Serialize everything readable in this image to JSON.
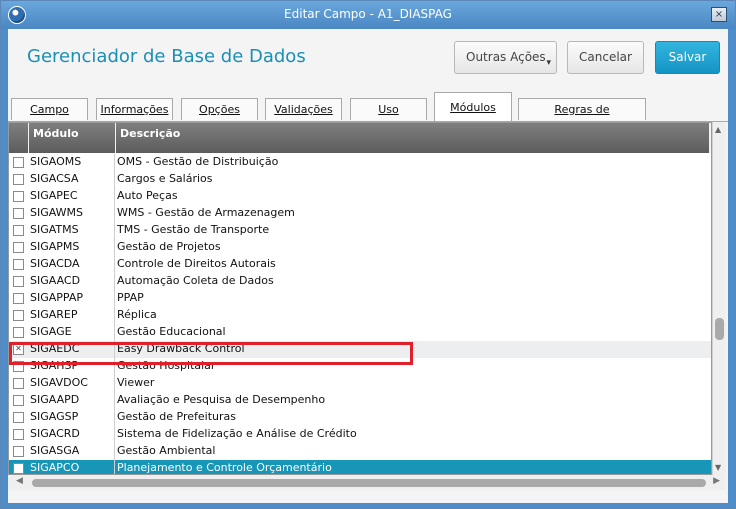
{
  "window": {
    "title": "Editar Campo - A1_DIASPAG",
    "close_label": "×"
  },
  "header": {
    "title": "Gerenciador de Base de Dados"
  },
  "toolbar": {
    "outras_label": "Outras Ações",
    "outras_caret": "▾",
    "cancel_label": "Cancelar",
    "save_label": "Salvar"
  },
  "tabs": [
    "Campo",
    "Informações",
    "Opções",
    "Validações",
    "Uso",
    "Módulos",
    "Regras de dependência"
  ],
  "active_tab": "Módulos",
  "grid": {
    "columns": [
      "Módulo",
      "Descrição"
    ],
    "rows": [
      {
        "module": "SIGAOMS",
        "desc": "OMS - Gestão de Distribuição",
        "checked": false
      },
      {
        "module": "SIGACSA",
        "desc": "Cargos e Salários",
        "checked": false
      },
      {
        "module": "SIGAPEC",
        "desc": "Auto Peças",
        "checked": false
      },
      {
        "module": "SIGAWMS",
        "desc": "WMS - Gestão de Armazenagem",
        "checked": false
      },
      {
        "module": "SIGATMS",
        "desc": "TMS - Gestão de Transporte",
        "checked": false
      },
      {
        "module": "SIGAPMS",
        "desc": "Gestão de Projetos",
        "checked": false
      },
      {
        "module": "SIGACDA",
        "desc": "Controle de Direitos Autorais",
        "checked": false
      },
      {
        "module": "SIGAACD",
        "desc": "Automação Coleta de Dados",
        "checked": false
      },
      {
        "module": "SIGAPPAP",
        "desc": "PPAP",
        "checked": false
      },
      {
        "module": "SIGAREP",
        "desc": "Réplica",
        "checked": false
      },
      {
        "module": "SIGAGE",
        "desc": "Gestão Educacional",
        "checked": false
      },
      {
        "module": "SIGAEDC",
        "desc": "Easy Drawback Control",
        "checked": true
      },
      {
        "module": "SIGAHSP",
        "desc": "Gestão Hospitalar",
        "checked": false
      },
      {
        "module": "SIGAVDOC",
        "desc": "Viewer",
        "checked": false
      },
      {
        "module": "SIGAAPD",
        "desc": "Avaliação e Pesquisa de Desempenho",
        "checked": false
      },
      {
        "module": "SIGAGSP",
        "desc": "Gestão de Prefeituras",
        "checked": false
      },
      {
        "module": "SIGACRD",
        "desc": "Sistema de Fidelização e Análise de Crédito",
        "checked": false
      },
      {
        "module": "SIGASGA",
        "desc": "Gestão Ambiental",
        "checked": false
      },
      {
        "module": "SIGAPCO",
        "desc": "Planejamento e Controle Orçamentário",
        "checked": false
      }
    ],
    "highlighted_module": "SIGAEDC",
    "selected_module": "SIGAPCO"
  },
  "colors": {
    "accent": "#1a8fb5",
    "selected_row": "#1796b8",
    "annotation_box": "#e0202a"
  }
}
